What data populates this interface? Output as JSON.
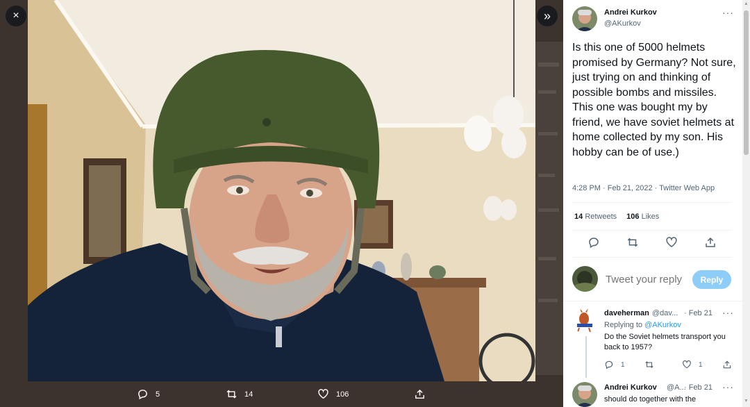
{
  "media": {
    "close_icon": "×",
    "expand_icon": "»",
    "replies": "5",
    "retweets": "14",
    "likes": "106"
  },
  "tweet": {
    "author_name": "Andrei Kurkov",
    "author_handle": "@AKurkov",
    "more_icon": "···",
    "text": "Is this one of 5000 helmets promised by Germany? Not sure, just trying on and thinking of possible bombs and missiles. This one was bought my by friend, we have soviet helmets at home collected by my son. His hobby can be of use.)",
    "time": "4:28 PM",
    "separator": " · ",
    "date": "Feb 21, 2022",
    "source": "Twitter Web App",
    "retweets_count": "14",
    "retweets_label": "Retweets",
    "likes_count": "106",
    "likes_label": "Likes"
  },
  "compose": {
    "placeholder": "Tweet your reply",
    "reply_label": "Reply"
  },
  "replies": [
    {
      "name": "daveherman",
      "handle": "@dav...",
      "date": "· Feb 21",
      "replying_prefix": "Replying to ",
      "replying_to": "@AKurkov",
      "text": "Do the Soviet helmets transport you back to 1957?",
      "reply_count": "1",
      "retweet_count": "",
      "like_count": "1"
    },
    {
      "name": "Andrei Kurkov",
      "handle": "@A...",
      "date": "· Feb 21",
      "text": "should do together with the"
    }
  ],
  "colors": {
    "accent": "#1d9bf0",
    "reply_button": "#8ecdf8",
    "helmet": "#465a2e",
    "jacket": "#15233a"
  }
}
